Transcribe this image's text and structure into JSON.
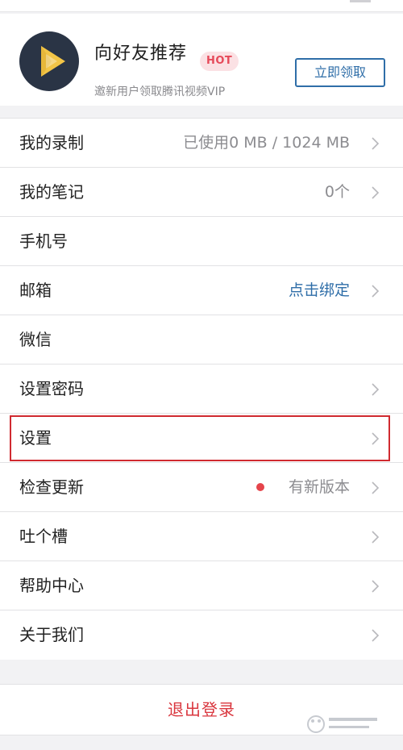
{
  "promo": {
    "title": "向好友推荐",
    "badge": "HOT",
    "subtitle": "邀新用户领取腾讯视频VIP",
    "claim_button": "立即领取"
  },
  "menu": [
    {
      "label": "我的录制",
      "value": "已使用0 MB / 1024 MB",
      "arrow": true
    },
    {
      "label": "我的笔记",
      "value": "0个",
      "arrow": true
    },
    {
      "label": "手机号",
      "value": "",
      "arrow": false
    },
    {
      "label": "邮箱",
      "value": "点击绑定",
      "arrow": true
    },
    {
      "label": "微信",
      "value": "",
      "arrow": false
    },
    {
      "label": "设置密码",
      "value": "",
      "arrow": true
    },
    {
      "label": "设置",
      "value": "",
      "arrow": true
    },
    {
      "label": "检查更新",
      "value": "有新版本",
      "arrow": true
    },
    {
      "label": "吐个槽",
      "value": "",
      "arrow": true
    },
    {
      "label": "帮助中心",
      "value": "",
      "arrow": true
    },
    {
      "label": "关于我们",
      "value": "",
      "arrow": true
    }
  ],
  "logout_button": "退出登录",
  "colors": {
    "accent_blue": "#2f6ea8",
    "danger_red": "#d9363e",
    "hot_badge_bg": "#fbe1e4",
    "logo_bg": "#2a3445",
    "update_dot": "#e5444b"
  },
  "icons": {
    "logo": "video-play-logo-icon",
    "row_arrow": "chevron-right-icon",
    "update": "red-dot-icon"
  }
}
